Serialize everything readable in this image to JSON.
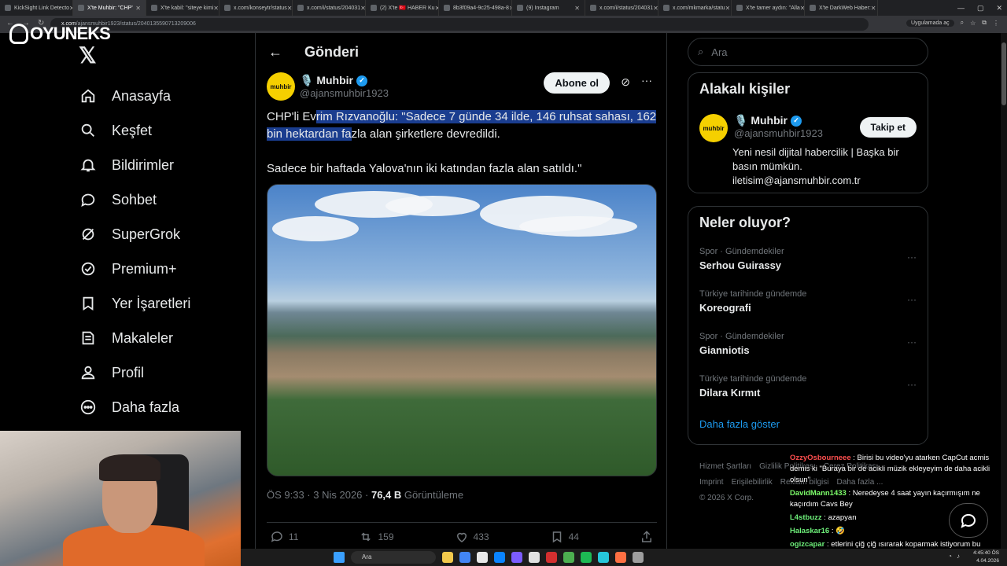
{
  "browser": {
    "tabs": [
      {
        "label": "KickSight Link Detecto"
      },
      {
        "label": "X'te Muhbir: \"CHP'",
        "active": true
      },
      {
        "label": "X'te kabil: \"siteye kimi"
      },
      {
        "label": "x.com/konseytr/status"
      },
      {
        "label": "x.com/i/status/204031"
      },
      {
        "label": "(2) X'te 🇹🇷 HABER Ku"
      },
      {
        "label": "8b3f09a4-9c25-498a-8"
      },
      {
        "label": "(9) Instagram"
      },
      {
        "label": "x.com/i/status/204031"
      },
      {
        "label": "x.com/mkmarka/statu"
      },
      {
        "label": "X'te tamer aydın: \"Alla"
      },
      {
        "label": "X'te DarkWeb Haber:"
      }
    ],
    "url_host": "x.com",
    "url_path": "/ajansmuhbir1923/status/2040135590713209006",
    "app_mode_label": "Uygulamada aç"
  },
  "overlay": {
    "logo_text": "OYUNEKS"
  },
  "sidebar": {
    "items": [
      {
        "label": "Anasayfa",
        "icon": "home-icon"
      },
      {
        "label": "Keşfet",
        "icon": "search-icon"
      },
      {
        "label": "Bildirimler",
        "icon": "bell-icon"
      },
      {
        "label": "Sohbet",
        "icon": "chat-icon"
      },
      {
        "label": "SuperGrok",
        "icon": "grok-icon"
      },
      {
        "label": "Premium+",
        "icon": "verified-icon"
      },
      {
        "label": "Yer İşaretleri",
        "icon": "bookmark-icon"
      },
      {
        "label": "Makaleler",
        "icon": "article-icon"
      },
      {
        "label": "Profil",
        "icon": "profile-icon"
      },
      {
        "label": "Daha fazla",
        "icon": "more-circle-icon"
      }
    ]
  },
  "post": {
    "header_title": "Gönderi",
    "author_name": "🎙️ Muhbir",
    "author_handle": "@ajansmuhbir1923",
    "avatar_text": "muhbir",
    "subscribe_label": "Abone ol",
    "text_part1": "CHP'li Ev",
    "text_highlight": "rim Rızvanoğlu: \"Sadece 7 günde 34 ilde, 146 ruhsat sahası, 162 bin hektardan fa",
    "text_part2": "zla alan şirketlere devredildi.",
    "text_line2": "Sadece bir haftada Yalova'nın iki katından fazla alan satıldı.\"",
    "time": "ÖS 9:33 · 3 Nis 2026 ·",
    "views": "76,4 B",
    "views_label": "Görüntüleme",
    "replies": "11",
    "reposts": "159",
    "likes": "433",
    "bookmarks": "44"
  },
  "search": {
    "placeholder": "Ara"
  },
  "related": {
    "title": "Alakalı kişiler",
    "name": "🎙️ Muhbir",
    "handle": "@ajansmuhbir1923",
    "bio": "Yeni nesil dijital habercilik | Başka bir basın mümkün. iletisim@ajansmuhbir.com.tr",
    "follow_label": "Takip et"
  },
  "trends": {
    "title": "Neler oluyor?",
    "items": [
      {
        "category": "Spor · Gündemdekiler",
        "topic": "Serhou Guirassy"
      },
      {
        "category": "Türkiye tarihinde gündemde",
        "topic": "Koreografi"
      },
      {
        "category": "Spor · Gündemdekiler",
        "topic": "Gianniotis"
      },
      {
        "category": "Türkiye tarihinde gündemde",
        "topic": "Dilara Kırmıt"
      }
    ],
    "show_more": "Daha fazla göster"
  },
  "footer": {
    "l1a": "Hizmet Şartları",
    "l1b": "Gizlilik Politikası",
    "l1c": "Çerez Politikası",
    "l2a": "Imprint",
    "l2b": "Erişilebilirlik",
    "l2c": "Reklam bilgisi",
    "l2d": "Daha fazla ...",
    "copy": "© 2026 X Corp."
  },
  "chat": [
    {
      "user": "OzzyOsbourneee",
      "text": "Birisi bu video'yu atarken CapCut acmis demis ki \"Buraya bir de acikli müzik ekleyeyim de daha acikli olsun\""
    },
    {
      "user": "DavidMann1433",
      "text": "Neredeyse 4 saat yayın kaçırmışım ne kaçırdım Cavs Bey"
    },
    {
      "user": "L4stbuzz",
      "text": "azapyan"
    },
    {
      "user": "Halaskar16",
      "text": "🤣"
    },
    {
      "user": "ogizcapar",
      "text": "etlerini çiğ çiğ ısırarak koparmak istiyorum bu orospu çocuğunun"
    }
  ],
  "taskbar": {
    "search": "Ara",
    "time": "4:45:40 ÖS",
    "date": "4.04.2026"
  }
}
